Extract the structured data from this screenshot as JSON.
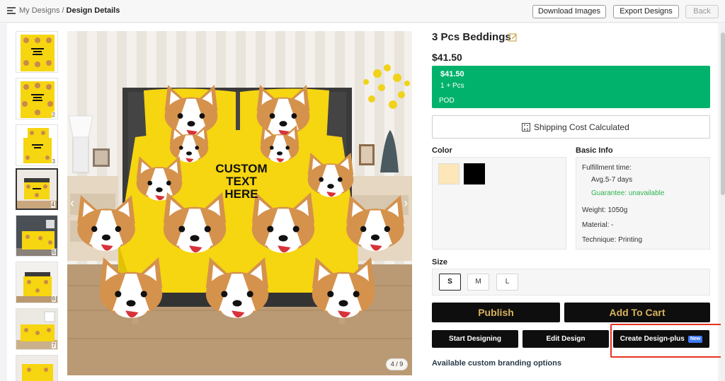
{
  "breadcrumb": {
    "root": "My Designs",
    "separator": "/",
    "current": "Design Details"
  },
  "top_actions": {
    "download_label": "Download Images",
    "export_label": "Export Designs",
    "back_label": "Back"
  },
  "gallery": {
    "thumbnails": [
      {
        "number": ""
      },
      {
        "number": "2"
      },
      {
        "number": "3"
      },
      {
        "number": "4"
      },
      {
        "number": "5"
      },
      {
        "number": "6"
      },
      {
        "number": "7"
      },
      {
        "number": ""
      }
    ],
    "active_index": 3,
    "counter": "4 / 9",
    "print_text_line1": "CUSTOM",
    "print_text_line2": "TEXT",
    "print_text_line3": "HERE"
  },
  "product": {
    "title": "3 Pcs Beddings",
    "price": "$41.50",
    "tier": {
      "price": "$41.50",
      "quantity": "1 + Pcs",
      "type": "POD"
    },
    "shipping_label": "Shipping Cost Calculated"
  },
  "color": {
    "label": "Color",
    "swatches": [
      "#fde7b8",
      "#000000"
    ]
  },
  "basic_info": {
    "label": "Basic Info",
    "fulfillment_label": "Fulfillment time:",
    "fulfillment_value": "Avg.5-7 days",
    "guarantee": "Guarantee: unavailable",
    "weight": "Weight: 1050g",
    "material": "Material: -",
    "technique": "Technique: Printing"
  },
  "size": {
    "label": "Size",
    "options": [
      "S",
      "M",
      "L"
    ],
    "selected": "S"
  },
  "actions": {
    "publish": "Publish",
    "add_to_cart": "Add To Cart",
    "start_designing": "Start Designing",
    "edit_design": "Edit Design",
    "create_design_plus": "Create Design-plus",
    "new_badge": "New"
  },
  "branding_heading": "Available custom branding options",
  "colors": {
    "accent_green": "#00b26b",
    "gold_text": "#d8b25d",
    "badge_blue": "#3d7bf7",
    "highlight_red": "#e8331f",
    "bedding_yellow": "#f6d511"
  }
}
